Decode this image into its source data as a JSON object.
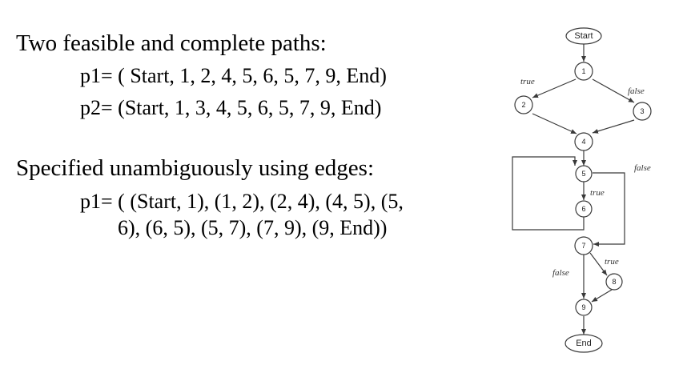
{
  "text": {
    "heading1": "Two feasible and complete paths:",
    "p1": "p1= ( Start, 1, 2, 4, 5, 6, 5, 7, 9, End)",
    "p2": "p2= (Start, 1, 3, 4, 5, 6, 5, 7, 9, End)",
    "heading2": "Specified unambiguously using edges:",
    "edges_line1": "p1= ( (Start, 1), (1, 2), (2, 4), (4, 5), (5,",
    "edges_line2": "6), (6, 5), (5, 7), (7, 9), (9, End))"
  },
  "graph": {
    "nodes": {
      "start": "Start",
      "n1": "1",
      "n2": "2",
      "n3": "3",
      "n4": "4",
      "n5": "5",
      "n6": "6",
      "n7": "7",
      "n8": "8",
      "n9": "9",
      "end": "End"
    },
    "edge_labels": {
      "e1_2": "true",
      "e1_3": "false",
      "e5_7": "false",
      "e5_6": "true",
      "e7_8": "true",
      "e7_9": "false"
    }
  },
  "colors": {
    "stroke": "#3a3a3a",
    "text": "#000000"
  }
}
